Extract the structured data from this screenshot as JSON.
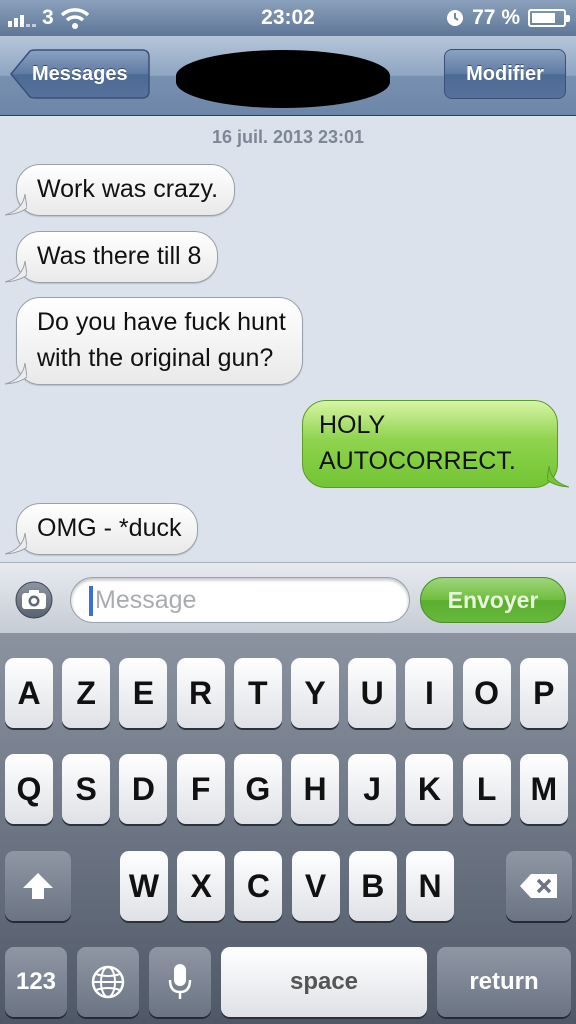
{
  "status_bar": {
    "carrier": "3",
    "time": "23:02",
    "battery_percent": "77 %",
    "battery_level": 0.77,
    "icons": [
      "signal-bars-icon",
      "wifi-icon",
      "rotation-lock-icon",
      "battery-icon"
    ]
  },
  "nav": {
    "back_label": "Messages",
    "edit_label": "Modifier"
  },
  "chat": {
    "timestamp": "16 juil. 2013 23:01",
    "messages": [
      {
        "direction": "incoming",
        "text": "Work was crazy."
      },
      {
        "direction": "incoming",
        "text": "Was there till 8"
      },
      {
        "direction": "incoming",
        "line1": "Do you have fuck hunt",
        "line2": "with the original gun?"
      },
      {
        "direction": "outgoing",
        "line1": "HOLY",
        "line2": "AUTOCORRECT."
      },
      {
        "direction": "incoming",
        "text": "OMG - *duck"
      }
    ]
  },
  "input": {
    "placeholder": "Message",
    "send_label": "Envoyer",
    "icons": [
      "camera-icon"
    ]
  },
  "keyboard": {
    "row1": [
      "A",
      "Z",
      "E",
      "R",
      "T",
      "Y",
      "U",
      "I",
      "O",
      "P"
    ],
    "row2": [
      "Q",
      "S",
      "D",
      "F",
      "G",
      "H",
      "J",
      "K",
      "L",
      "M"
    ],
    "row3": [
      "W",
      "X",
      "C",
      "V",
      "B",
      "N"
    ],
    "numbers_label": "123",
    "space_label": "space",
    "return_label": "return",
    "icons": [
      "shift-icon",
      "delete-icon",
      "globe-icon",
      "microphone-icon"
    ]
  },
  "colors": {
    "incoming_bubble": "#ffffff",
    "outgoing_bubble": "#8fd34d",
    "chat_background": "#dbe2ec",
    "nav_bar": "#7890b0",
    "send_button": "#6fbd3f"
  }
}
